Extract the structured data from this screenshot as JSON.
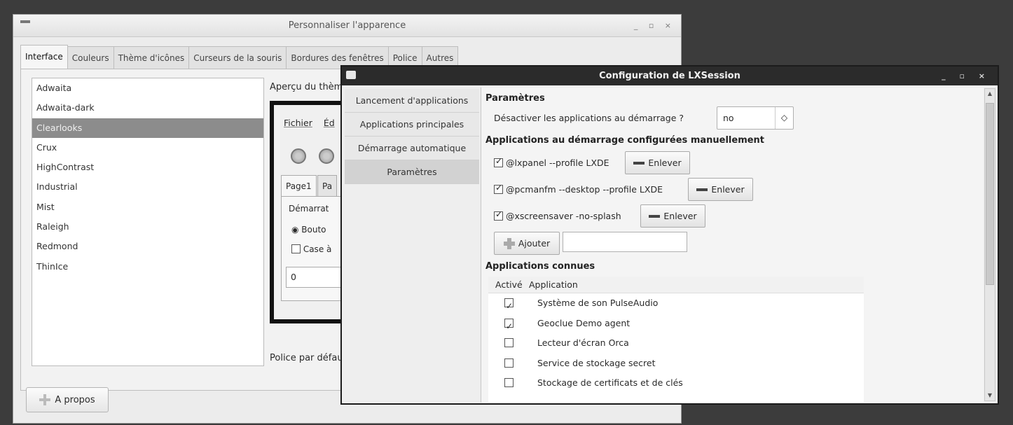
{
  "appearance": {
    "title": "Personnaliser l'apparence",
    "window_buttons": "_ ▫ ×",
    "tabs": [
      "Interface",
      "Couleurs",
      "Thème d'icônes",
      "Curseurs de la souris",
      "Bordures des fenêtres",
      "Police",
      "Autres"
    ],
    "themes": [
      "Adwaita",
      "Adwaita-dark",
      "Clearlooks",
      "Crux",
      "HighContrast",
      "Industrial",
      "Mist",
      "Raleigh",
      "Redmond",
      "ThinIce"
    ],
    "selected_theme": "Clearlooks",
    "preview_label": "Aperçu du thème",
    "preview": {
      "menu_file": "Fichier",
      "menu_edit": "Éd",
      "tab1": "Page1",
      "tab2": "Pa",
      "frame_label": "Démarrat",
      "radio_label": "Bouto",
      "check_label": "Case à",
      "entry_value": "0"
    },
    "font_label": "Police par défaut",
    "about_button": "A propos"
  },
  "lxsession": {
    "title": "Configuration de LXSession",
    "window_buttons": "_ ▫ ×",
    "side_tabs": [
      "Lancement d'applications",
      "Applications principales",
      "Démarrage automatique",
      "Paramètres"
    ],
    "active_side_tab": "Paramètres",
    "params_title": "Paramètres",
    "disable_label": "Désactiver les applications au démarrage ?",
    "disable_value": "no",
    "manual_title": "Applications au démarrage configurées manuellement",
    "manual_items": [
      {
        "cmd": "@lxpanel --profile LXDE",
        "checked": true
      },
      {
        "cmd": "@pcmanfm --desktop --profile LXDE",
        "checked": true
      },
      {
        "cmd": "@xscreensaver -no-splash",
        "checked": true
      }
    ],
    "remove_label": "Enlever",
    "add_label": "Ajouter",
    "add_entry_value": "",
    "known_title": "Applications connues",
    "known_headers": [
      "Activé",
      "Application"
    ],
    "known_items": [
      {
        "name": "Système de son PulseAudio",
        "checked": true
      },
      {
        "name": "Geoclue Demo agent",
        "checked": true
      },
      {
        "name": "Lecteur d'écran Orca",
        "checked": false
      },
      {
        "name": "Service de stockage secret",
        "checked": false
      },
      {
        "name": "Stockage de certificats et de clés",
        "checked": false
      }
    ]
  }
}
